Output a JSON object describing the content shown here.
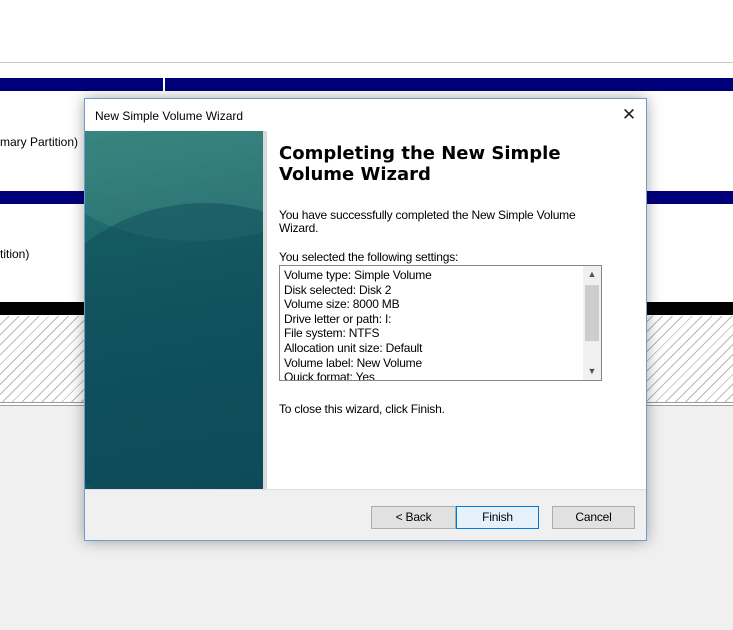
{
  "background": {
    "partitions": [
      {
        "label": "mary Partition)"
      },
      {
        "label": "tition)"
      }
    ]
  },
  "dialog": {
    "title": "New Simple Volume Wizard",
    "close_glyph": "✕",
    "heading": "Completing the New Simple Volume Wizard",
    "success_text": "You have successfully completed the New Simple Volume Wizard.",
    "settings_label": "You selected the following settings:",
    "settings": [
      "Volume type: Simple Volume",
      "Disk selected: Disk 2",
      "Volume size: 8000 MB",
      "Drive letter or path: I:",
      "File system: NTFS",
      "Allocation unit size: Default",
      "Volume label: New Volume",
      "Quick format: Yes"
    ],
    "scroll_up_glyph": "▲",
    "scroll_down_glyph": "▼",
    "close_hint": "To close this wizard, click Finish.",
    "buttons": {
      "back": "< Back",
      "finish": "Finish",
      "cancel": "Cancel"
    }
  },
  "colors": {
    "disk_bar": "#00007a",
    "unallocated_bar": "#000000",
    "wizard_side_panel": "#135a66",
    "default_button_border": "#0078d7"
  },
  "icons": {
    "close": "close-icon",
    "scroll_up": "scroll-up-icon",
    "scroll_down": "scroll-down-icon"
  }
}
